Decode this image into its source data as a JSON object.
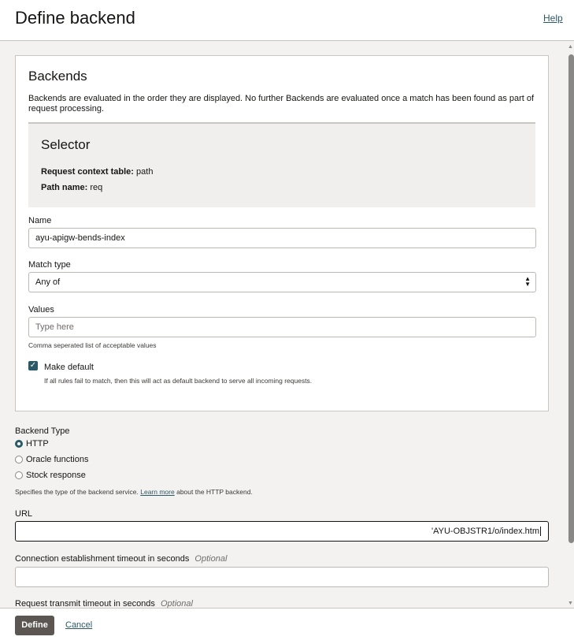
{
  "header": {
    "title": "Define backend",
    "help": "Help"
  },
  "backends": {
    "title": "Backends",
    "description": "Backends are evaluated in the order they are displayed. No further Backends are evaluated once a match has been found as part of request processing.",
    "selector": {
      "title": "Selector",
      "context_label": "Request context table:",
      "context_value": "path",
      "path_label": "Path name:",
      "path_value": "req"
    },
    "name": {
      "label": "Name",
      "value": "ayu-apigw-bends-index"
    },
    "match_type": {
      "label": "Match type",
      "value": "Any of"
    },
    "values": {
      "label": "Values",
      "placeholder": "Type here",
      "helper": "Comma seperated list of acceptable values"
    },
    "make_default": {
      "label": "Make default",
      "checked": true,
      "helper": "If all rules fail to match, then this will act as default backend to serve all incoming requests."
    }
  },
  "backend_type": {
    "label": "Backend Type",
    "options": [
      "HTTP",
      "Oracle functions",
      "Stock response"
    ],
    "selected": "HTTP",
    "helper_pre": "Specifies the type of the backend service.",
    "helper_link": "Learn more",
    "helper_post": "about the HTTP backend."
  },
  "url": {
    "label": "URL",
    "value": "'AYU-OBJSTR1/o/index.htm"
  },
  "conn_timeout": {
    "label": "Connection establishment timeout in seconds",
    "optional": "Optional",
    "value": ""
  },
  "transmit_timeout": {
    "label": "Request transmit timeout in seconds",
    "optional": "Optional"
  },
  "footer": {
    "define": "Define",
    "cancel": "Cancel"
  },
  "colors": {
    "accent": "#2c5967",
    "primary_button": "#5b5652"
  }
}
